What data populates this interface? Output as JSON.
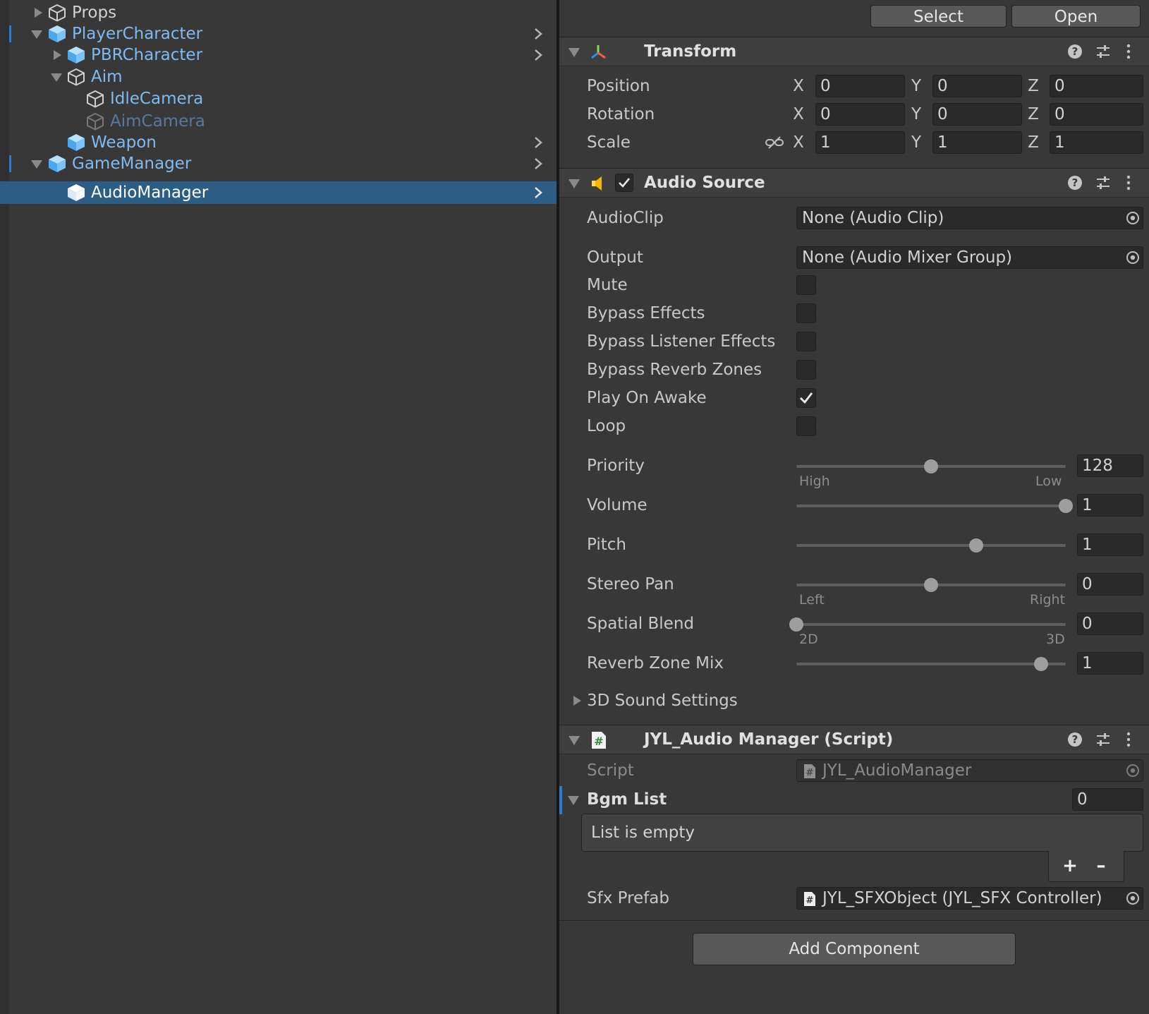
{
  "hierarchy": {
    "items": [
      {
        "label": "Props",
        "style": "plain"
      },
      {
        "label": "PlayerCharacter",
        "style": "prefab"
      },
      {
        "label": "PBRCharacter",
        "style": "prefab"
      },
      {
        "label": "Aim",
        "style": "prefab"
      },
      {
        "label": "IdleCamera",
        "style": "prefab"
      },
      {
        "label": "AimCamera",
        "style": "inactive"
      },
      {
        "label": "Weapon",
        "style": "prefab"
      },
      {
        "label": "GameManager",
        "style": "prefab"
      },
      {
        "label": "AudioManager",
        "style": "selected"
      }
    ]
  },
  "prefab_bar": {
    "select_label": "Select",
    "open_label": "Open"
  },
  "transform": {
    "title": "Transform",
    "position_label": "Position",
    "rotation_label": "Rotation",
    "scale_label": "Scale",
    "axis_x": "X",
    "axis_y": "Y",
    "axis_z": "Z",
    "position": {
      "x": "0",
      "y": "0",
      "z": "0"
    },
    "rotation": {
      "x": "0",
      "y": "0",
      "z": "0"
    },
    "scale": {
      "x": "1",
      "y": "1",
      "z": "1"
    }
  },
  "audio_source": {
    "title": "Audio Source",
    "enabled": true,
    "audioclip_label": "AudioClip",
    "audioclip_value": "None (Audio Clip)",
    "output_label": "Output",
    "output_value": "None (Audio Mixer Group)",
    "toggles": [
      {
        "label": "Mute",
        "checked": false
      },
      {
        "label": "Bypass Effects",
        "checked": false
      },
      {
        "label": "Bypass Listener Effects",
        "checked": false
      },
      {
        "label": "Bypass Reverb Zones",
        "checked": false
      },
      {
        "label": "Play On Awake",
        "checked": true
      },
      {
        "label": "Loop",
        "checked": false
      }
    ],
    "sliders": {
      "priority": {
        "label": "Priority",
        "value": "128",
        "min": 0,
        "max": 256,
        "left_caption": "High",
        "right_caption": "Low"
      },
      "volume": {
        "label": "Volume",
        "value": "1",
        "min": 0,
        "max": 1
      },
      "pitch": {
        "label": "Pitch",
        "value": "1",
        "min": -3,
        "max": 3
      },
      "stereo_pan": {
        "label": "Stereo Pan",
        "value": "0",
        "min": -1,
        "max": 1,
        "left_caption": "Left",
        "right_caption": "Right"
      },
      "spatial_blend": {
        "label": "Spatial Blend",
        "value": "0",
        "min": 0,
        "max": 1,
        "left_caption": "2D",
        "right_caption": "3D"
      },
      "reverb_zone_mix": {
        "label": "Reverb Zone Mix",
        "value": "1",
        "min": 0,
        "max": 1.1
      }
    },
    "sound_settings_label": "3D Sound Settings"
  },
  "audio_manager_script": {
    "title": "JYL_Audio Manager (Script)",
    "script_label": "Script",
    "script_value": "JYL_AudioManager",
    "bgm_list_label": "Bgm List",
    "bgm_list_size": "0",
    "list_empty_text": "List is empty",
    "add_symbol": "+",
    "remove_symbol": "–",
    "sfx_prefab_label": "Sfx Prefab",
    "sfx_prefab_value": "JYL_SFXObject (JYL_SFX Controller)"
  },
  "add_component_label": "Add Component",
  "colors": {
    "selection": "#2c5d87",
    "prefab_text": "#7fbaf0",
    "panel_bg": "#383838",
    "field_bg": "#2a2a2a",
    "accent_marker": "#2a7bd1"
  }
}
